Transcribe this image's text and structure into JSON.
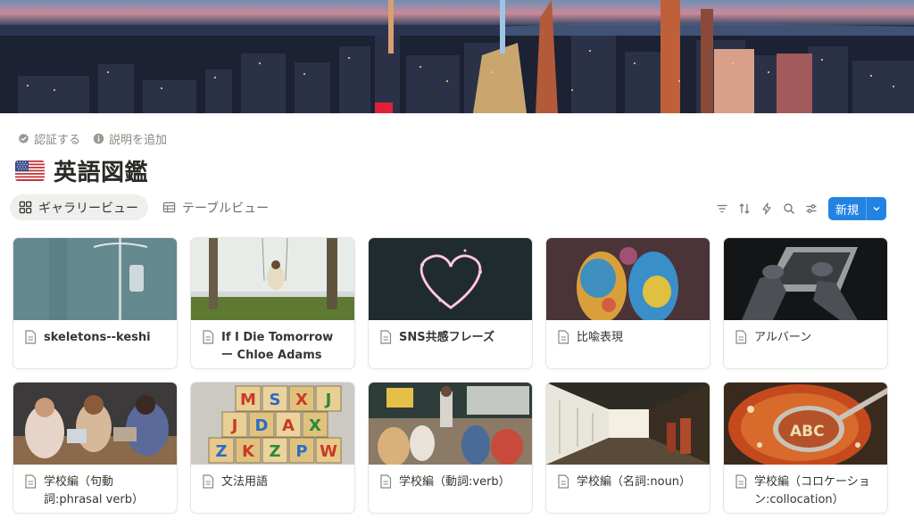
{
  "page": {
    "meta_actions": [
      {
        "label": "認証する",
        "icon": "verified-check-icon"
      },
      {
        "label": "説明を追加",
        "icon": "info-icon"
      }
    ],
    "flag": "us-flag-icon",
    "title": "英語図鑑"
  },
  "toolbar": {
    "views": [
      {
        "label": "ギャラリービュー",
        "icon": "gallery-grid-icon",
        "active": true
      },
      {
        "label": "テーブルビュー",
        "icon": "table-icon",
        "active": false
      }
    ],
    "tools": [
      "filter-icon",
      "sort-icon",
      "automation-bolt-icon",
      "search-icon",
      "settings-sliders-icon"
    ],
    "new_button": "新規"
  },
  "gallery": {
    "cards": [
      {
        "title": "skeletons--keshi",
        "image": "iv-drip-stand"
      },
      {
        "title": "If I Die Tomorrow ー Chloe Adams",
        "image": "girl-on-swing"
      },
      {
        "title": "SNS共感フレーズ",
        "image": "sparkler-heart"
      },
      {
        "title": "比喩表現",
        "image": "colorful-powder-hands"
      },
      {
        "title": "アルバーン",
        "image": "hands-on-laptop"
      },
      {
        "title": "学校編（句動詞:phrasal verb）",
        "image": "students-at-table"
      },
      {
        "title": "文法用語",
        "image": "alphabet-blocks"
      },
      {
        "title": "学校編（動詞:verb）",
        "image": "classroom"
      },
      {
        "title": "学校編（名詞:noun）",
        "image": "school-hallway"
      },
      {
        "title": "学校編（コロケーション:collocation）",
        "image": "alphabet-soup-spoon"
      }
    ]
  },
  "colors": {
    "accent": "#2383e2",
    "text": "#37352f",
    "muted": "#8a8780",
    "active_tab_bg": "#efefed"
  }
}
